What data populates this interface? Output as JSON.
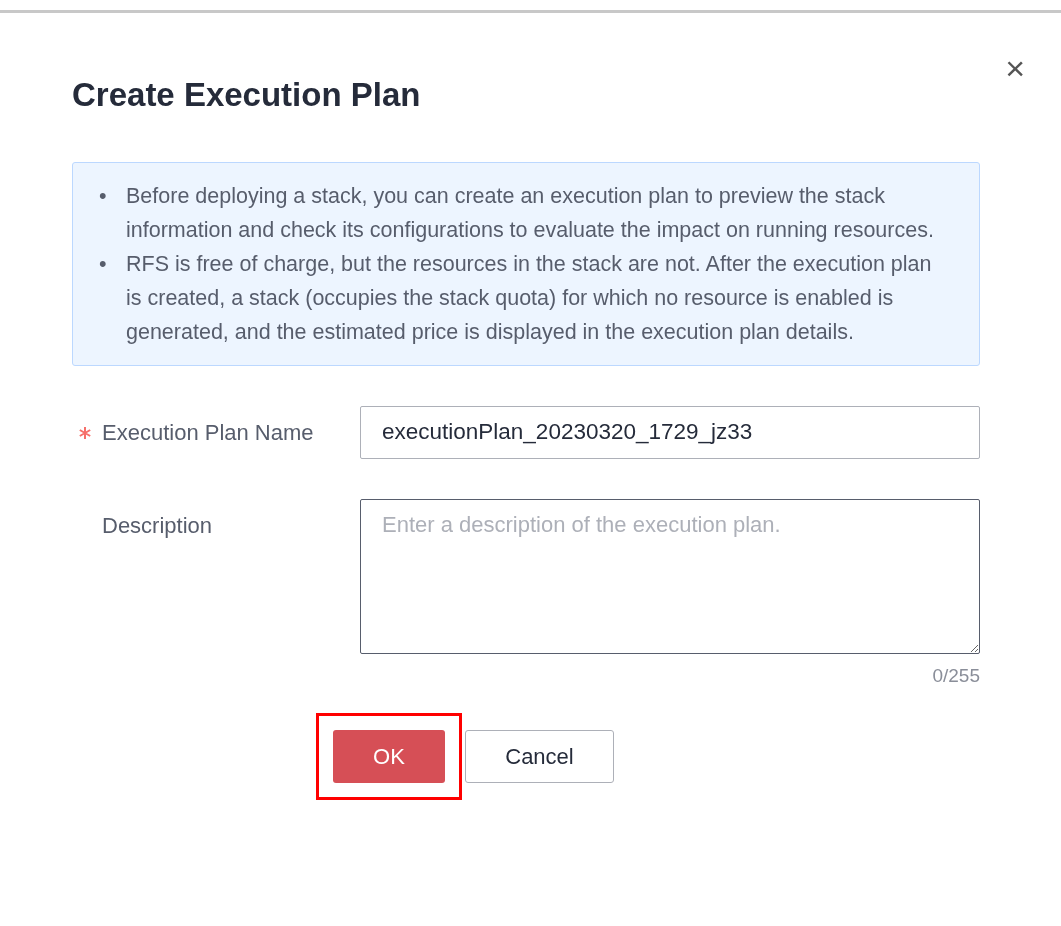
{
  "dialog": {
    "title": "Create Execution Plan",
    "close": "×"
  },
  "notice": [
    {
      "bullet": "•",
      "text": "Before deploying a stack, you can create an execution plan to preview the stack information and check its configurations to evaluate the impact on running resources."
    },
    {
      "bullet": "•",
      "text": "RFS is free of charge, but the resources in the stack are not. After the execution plan is created, a stack (occupies the stack quota) for which no resource is enabled is generated, and the estimated price is displayed in the execution plan details."
    }
  ],
  "fields": [
    {
      "kind": "input",
      "label": "Execution Plan Name",
      "required": true,
      "value": "executionPlan_20230320_1729_jz33"
    },
    {
      "kind": "textarea",
      "label": "Description",
      "required": false,
      "placeholder": "Enter a description of the execution plan.",
      "counter": "0/255"
    }
  ],
  "buttons": [
    {
      "label": "OK",
      "kind": "primary",
      "highlighted": true
    },
    {
      "label": "Cancel",
      "kind": "secondary",
      "highlighted": false
    }
  ]
}
